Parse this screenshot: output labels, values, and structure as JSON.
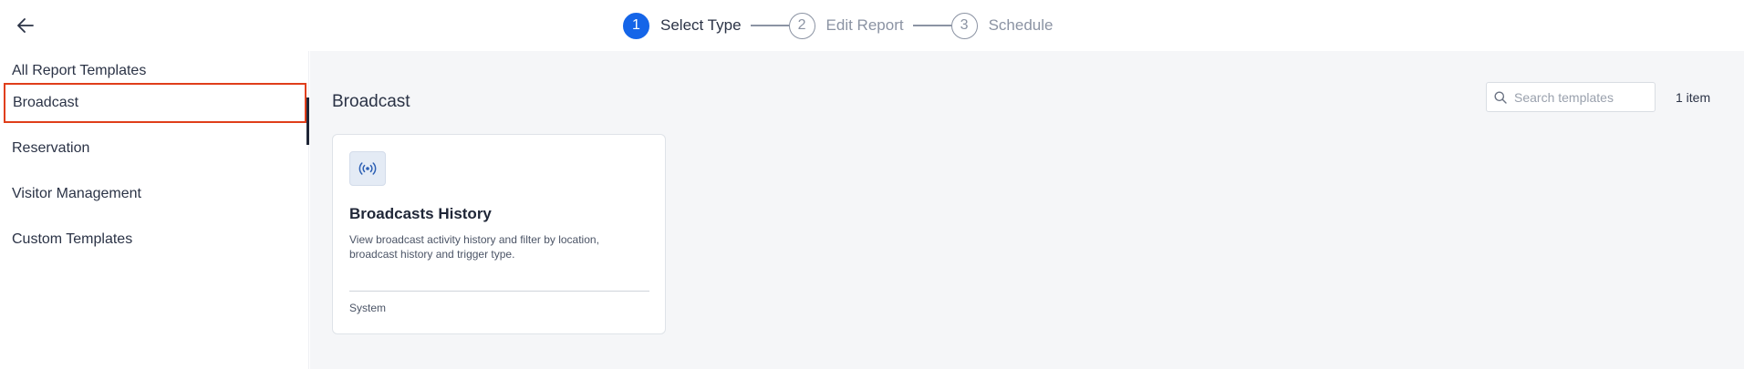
{
  "header": {
    "back_icon": "arrow-left-icon",
    "steps": [
      {
        "number": "1",
        "label": "Select Type",
        "active": true
      },
      {
        "number": "2",
        "label": "Edit Report",
        "active": false
      },
      {
        "number": "3",
        "label": "Schedule",
        "active": false
      }
    ]
  },
  "sidebar": {
    "items": [
      {
        "label": "All Report Templates"
      },
      {
        "label": "Broadcast",
        "selected": true
      },
      {
        "label": "Reservation"
      },
      {
        "label": "Visitor Management"
      },
      {
        "label": "Custom Templates"
      }
    ]
  },
  "main": {
    "title": "Broadcast",
    "search": {
      "placeholder": "Search templates",
      "value": "",
      "icon": "search-icon"
    },
    "item_count": "1 item",
    "cards": [
      {
        "icon": "broadcast-icon",
        "title": "Broadcasts History",
        "description": "View broadcast activity history and filter by location, broadcast history and trigger type.",
        "footer": "System"
      }
    ]
  },
  "colors": {
    "accent": "#1565e8",
    "selection_outline": "#e03e1a",
    "main_background": "#f5f6f8"
  }
}
